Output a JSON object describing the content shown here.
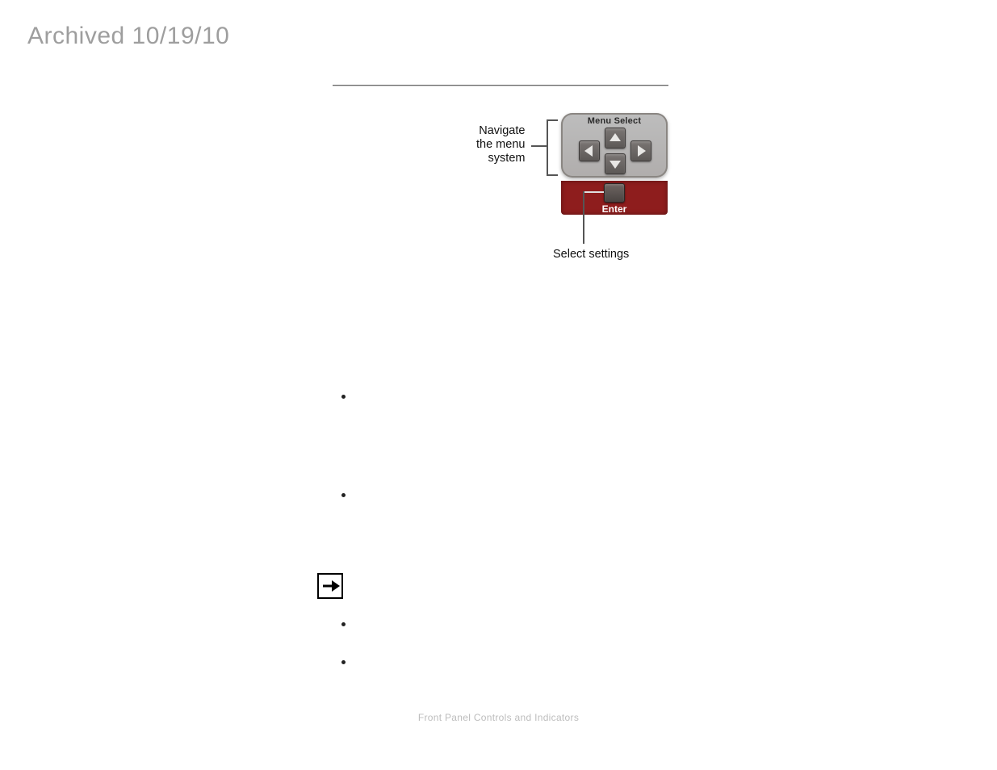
{
  "watermark": "Archived 10/19/10",
  "figure": {
    "nav_label_line1": "Navigate",
    "nav_label_line2": "the menu",
    "nav_label_line3": "system",
    "panel_title": "Menu Select",
    "enter_label": "Enter",
    "select_settings": "Select settings"
  },
  "footer": "Front Panel Controls and Indicators"
}
